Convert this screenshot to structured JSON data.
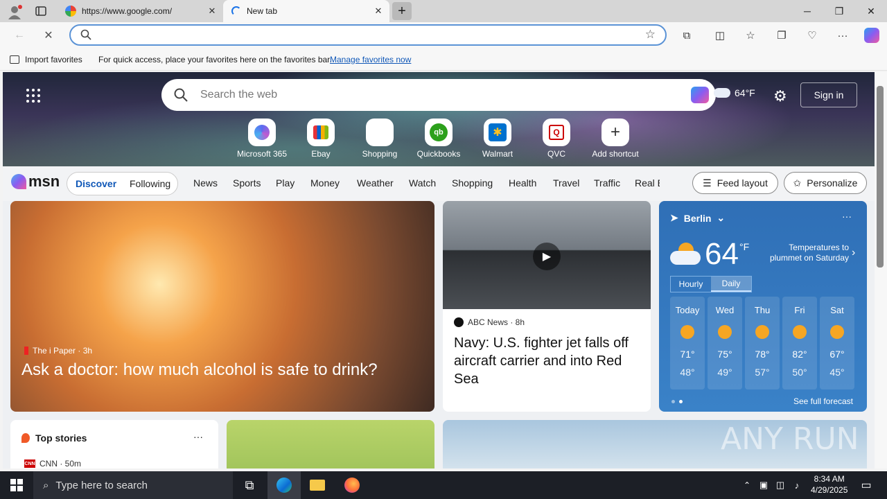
{
  "browser": {
    "tabs": [
      {
        "title": "https://www.google.com/",
        "close": "✕"
      },
      {
        "title": "New tab",
        "close": "✕"
      }
    ],
    "new_tab": "+",
    "window": {
      "minimize": "─",
      "restore": "❐",
      "close": "✕"
    }
  },
  "favorites_bar": {
    "import_label": "Import favorites",
    "message": "For quick access, place your favorites here on the favorites bar.",
    "manage_link": "Manage favorites now"
  },
  "newtab": {
    "search_placeholder": "Search the web",
    "weather_temp": "64°F",
    "sign_in": "Sign in",
    "shortcuts": [
      {
        "label": "Microsoft 365",
        "icon": "microsoft-365-icon"
      },
      {
        "label": "Ebay",
        "icon": "ebay-icon"
      },
      {
        "label": "Shopping",
        "icon": "shopping-tag-icon"
      },
      {
        "label": "Quickbooks",
        "icon": "quickbooks-icon"
      },
      {
        "label": "Walmart",
        "icon": "walmart-icon"
      },
      {
        "label": "QVC",
        "icon": "qvc-icon"
      },
      {
        "label": "Add shortcut",
        "icon": "plus-icon"
      }
    ]
  },
  "msn": {
    "logo": "msn",
    "discover": "Discover",
    "following": "Following",
    "nav": [
      "News",
      "Sports",
      "Play",
      "Money",
      "Weather",
      "Watch",
      "Shopping",
      "Health",
      "Travel",
      "Traffic",
      "Real E"
    ],
    "feed_layout": "Feed layout",
    "personalize": "Personalize"
  },
  "cards": {
    "main": {
      "source": "The i Paper · 3h",
      "headline": "Ask a doctor: how much alcohol is safe to drink?"
    },
    "video": {
      "source": "ABC News · 8h",
      "headline": "Navy: U.S. fighter jet falls off aircraft carrier and into Red Sea"
    },
    "top_stories": {
      "title": "Top stories",
      "source": "CNN · 50m"
    }
  },
  "weather": {
    "city": "Berlin",
    "temp": "64",
    "unit": "°F",
    "alert": "Temperatures to plummet on Saturday",
    "tab_hourly": "Hourly",
    "tab_daily": "Daily",
    "days": [
      {
        "name": "Today",
        "hi": "71°",
        "lo": "48°"
      },
      {
        "name": "Wed",
        "hi": "75°",
        "lo": "49°"
      },
      {
        "name": "Thu",
        "hi": "78°",
        "lo": "57°"
      },
      {
        "name": "Fri",
        "hi": "82°",
        "lo": "50°"
      },
      {
        "name": "Sat",
        "hi": "67°",
        "lo": "45°"
      }
    ],
    "see_full": "See full forecast",
    "more": "···"
  },
  "watermark": "ANY RUN",
  "taskbar": {
    "search_placeholder": "Type here to search",
    "time": "8:34 AM",
    "date": "4/29/2025"
  }
}
